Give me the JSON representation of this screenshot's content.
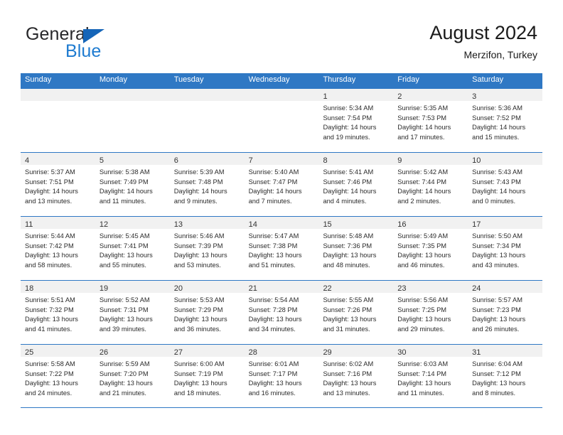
{
  "brand": {
    "name_part1": "General",
    "name_part2": "Blue",
    "triangle_color": "#1565b8",
    "blue_color": "#1e7bd0"
  },
  "header": {
    "title": "August 2024",
    "subtitle": "Merzifon, Turkey"
  },
  "colors": {
    "header_blue": "#2f78c4",
    "daynum_band": "#f1f1f1",
    "text": "#2b2b2b"
  },
  "day_headers": [
    "Sunday",
    "Monday",
    "Tuesday",
    "Wednesday",
    "Thursday",
    "Friday",
    "Saturday"
  ],
  "weeks": [
    [
      {
        "day": "",
        "empty": true,
        "sunrise": "",
        "sunset": "",
        "daylight1": "",
        "daylight2": ""
      },
      {
        "day": "",
        "empty": true,
        "sunrise": "",
        "sunset": "",
        "daylight1": "",
        "daylight2": ""
      },
      {
        "day": "",
        "empty": true,
        "sunrise": "",
        "sunset": "",
        "daylight1": "",
        "daylight2": ""
      },
      {
        "day": "",
        "empty": true,
        "sunrise": "",
        "sunset": "",
        "daylight1": "",
        "daylight2": ""
      },
      {
        "day": "1",
        "empty": false,
        "sunrise": "Sunrise: 5:34 AM",
        "sunset": "Sunset: 7:54 PM",
        "daylight1": "Daylight: 14 hours",
        "daylight2": "and 19 minutes."
      },
      {
        "day": "2",
        "empty": false,
        "sunrise": "Sunrise: 5:35 AM",
        "sunset": "Sunset: 7:53 PM",
        "daylight1": "Daylight: 14 hours",
        "daylight2": "and 17 minutes."
      },
      {
        "day": "3",
        "empty": false,
        "sunrise": "Sunrise: 5:36 AM",
        "sunset": "Sunset: 7:52 PM",
        "daylight1": "Daylight: 14 hours",
        "daylight2": "and 15 minutes."
      }
    ],
    [
      {
        "day": "4",
        "empty": false,
        "sunrise": "Sunrise: 5:37 AM",
        "sunset": "Sunset: 7:51 PM",
        "daylight1": "Daylight: 14 hours",
        "daylight2": "and 13 minutes."
      },
      {
        "day": "5",
        "empty": false,
        "sunrise": "Sunrise: 5:38 AM",
        "sunset": "Sunset: 7:49 PM",
        "daylight1": "Daylight: 14 hours",
        "daylight2": "and 11 minutes."
      },
      {
        "day": "6",
        "empty": false,
        "sunrise": "Sunrise: 5:39 AM",
        "sunset": "Sunset: 7:48 PM",
        "daylight1": "Daylight: 14 hours",
        "daylight2": "and 9 minutes."
      },
      {
        "day": "7",
        "empty": false,
        "sunrise": "Sunrise: 5:40 AM",
        "sunset": "Sunset: 7:47 PM",
        "daylight1": "Daylight: 14 hours",
        "daylight2": "and 7 minutes."
      },
      {
        "day": "8",
        "empty": false,
        "sunrise": "Sunrise: 5:41 AM",
        "sunset": "Sunset: 7:46 PM",
        "daylight1": "Daylight: 14 hours",
        "daylight2": "and 4 minutes."
      },
      {
        "day": "9",
        "empty": false,
        "sunrise": "Sunrise: 5:42 AM",
        "sunset": "Sunset: 7:44 PM",
        "daylight1": "Daylight: 14 hours",
        "daylight2": "and 2 minutes."
      },
      {
        "day": "10",
        "empty": false,
        "sunrise": "Sunrise: 5:43 AM",
        "sunset": "Sunset: 7:43 PM",
        "daylight1": "Daylight: 14 hours",
        "daylight2": "and 0 minutes."
      }
    ],
    [
      {
        "day": "11",
        "empty": false,
        "sunrise": "Sunrise: 5:44 AM",
        "sunset": "Sunset: 7:42 PM",
        "daylight1": "Daylight: 13 hours",
        "daylight2": "and 58 minutes."
      },
      {
        "day": "12",
        "empty": false,
        "sunrise": "Sunrise: 5:45 AM",
        "sunset": "Sunset: 7:41 PM",
        "daylight1": "Daylight: 13 hours",
        "daylight2": "and 55 minutes."
      },
      {
        "day": "13",
        "empty": false,
        "sunrise": "Sunrise: 5:46 AM",
        "sunset": "Sunset: 7:39 PM",
        "daylight1": "Daylight: 13 hours",
        "daylight2": "and 53 minutes."
      },
      {
        "day": "14",
        "empty": false,
        "sunrise": "Sunrise: 5:47 AM",
        "sunset": "Sunset: 7:38 PM",
        "daylight1": "Daylight: 13 hours",
        "daylight2": "and 51 minutes."
      },
      {
        "day": "15",
        "empty": false,
        "sunrise": "Sunrise: 5:48 AM",
        "sunset": "Sunset: 7:36 PM",
        "daylight1": "Daylight: 13 hours",
        "daylight2": "and 48 minutes."
      },
      {
        "day": "16",
        "empty": false,
        "sunrise": "Sunrise: 5:49 AM",
        "sunset": "Sunset: 7:35 PM",
        "daylight1": "Daylight: 13 hours",
        "daylight2": "and 46 minutes."
      },
      {
        "day": "17",
        "empty": false,
        "sunrise": "Sunrise: 5:50 AM",
        "sunset": "Sunset: 7:34 PM",
        "daylight1": "Daylight: 13 hours",
        "daylight2": "and 43 minutes."
      }
    ],
    [
      {
        "day": "18",
        "empty": false,
        "sunrise": "Sunrise: 5:51 AM",
        "sunset": "Sunset: 7:32 PM",
        "daylight1": "Daylight: 13 hours",
        "daylight2": "and 41 minutes."
      },
      {
        "day": "19",
        "empty": false,
        "sunrise": "Sunrise: 5:52 AM",
        "sunset": "Sunset: 7:31 PM",
        "daylight1": "Daylight: 13 hours",
        "daylight2": "and 39 minutes."
      },
      {
        "day": "20",
        "empty": false,
        "sunrise": "Sunrise: 5:53 AM",
        "sunset": "Sunset: 7:29 PM",
        "daylight1": "Daylight: 13 hours",
        "daylight2": "and 36 minutes."
      },
      {
        "day": "21",
        "empty": false,
        "sunrise": "Sunrise: 5:54 AM",
        "sunset": "Sunset: 7:28 PM",
        "daylight1": "Daylight: 13 hours",
        "daylight2": "and 34 minutes."
      },
      {
        "day": "22",
        "empty": false,
        "sunrise": "Sunrise: 5:55 AM",
        "sunset": "Sunset: 7:26 PM",
        "daylight1": "Daylight: 13 hours",
        "daylight2": "and 31 minutes."
      },
      {
        "day": "23",
        "empty": false,
        "sunrise": "Sunrise: 5:56 AM",
        "sunset": "Sunset: 7:25 PM",
        "daylight1": "Daylight: 13 hours",
        "daylight2": "and 29 minutes."
      },
      {
        "day": "24",
        "empty": false,
        "sunrise": "Sunrise: 5:57 AM",
        "sunset": "Sunset: 7:23 PM",
        "daylight1": "Daylight: 13 hours",
        "daylight2": "and 26 minutes."
      }
    ],
    [
      {
        "day": "25",
        "empty": false,
        "sunrise": "Sunrise: 5:58 AM",
        "sunset": "Sunset: 7:22 PM",
        "daylight1": "Daylight: 13 hours",
        "daylight2": "and 24 minutes."
      },
      {
        "day": "26",
        "empty": false,
        "sunrise": "Sunrise: 5:59 AM",
        "sunset": "Sunset: 7:20 PM",
        "daylight1": "Daylight: 13 hours",
        "daylight2": "and 21 minutes."
      },
      {
        "day": "27",
        "empty": false,
        "sunrise": "Sunrise: 6:00 AM",
        "sunset": "Sunset: 7:19 PM",
        "daylight1": "Daylight: 13 hours",
        "daylight2": "and 18 minutes."
      },
      {
        "day": "28",
        "empty": false,
        "sunrise": "Sunrise: 6:01 AM",
        "sunset": "Sunset: 7:17 PM",
        "daylight1": "Daylight: 13 hours",
        "daylight2": "and 16 minutes."
      },
      {
        "day": "29",
        "empty": false,
        "sunrise": "Sunrise: 6:02 AM",
        "sunset": "Sunset: 7:16 PM",
        "daylight1": "Daylight: 13 hours",
        "daylight2": "and 13 minutes."
      },
      {
        "day": "30",
        "empty": false,
        "sunrise": "Sunrise: 6:03 AM",
        "sunset": "Sunset: 7:14 PM",
        "daylight1": "Daylight: 13 hours",
        "daylight2": "and 11 minutes."
      },
      {
        "day": "31",
        "empty": false,
        "sunrise": "Sunrise: 6:04 AM",
        "sunset": "Sunset: 7:12 PM",
        "daylight1": "Daylight: 13 hours",
        "daylight2": "and 8 minutes."
      }
    ]
  ]
}
